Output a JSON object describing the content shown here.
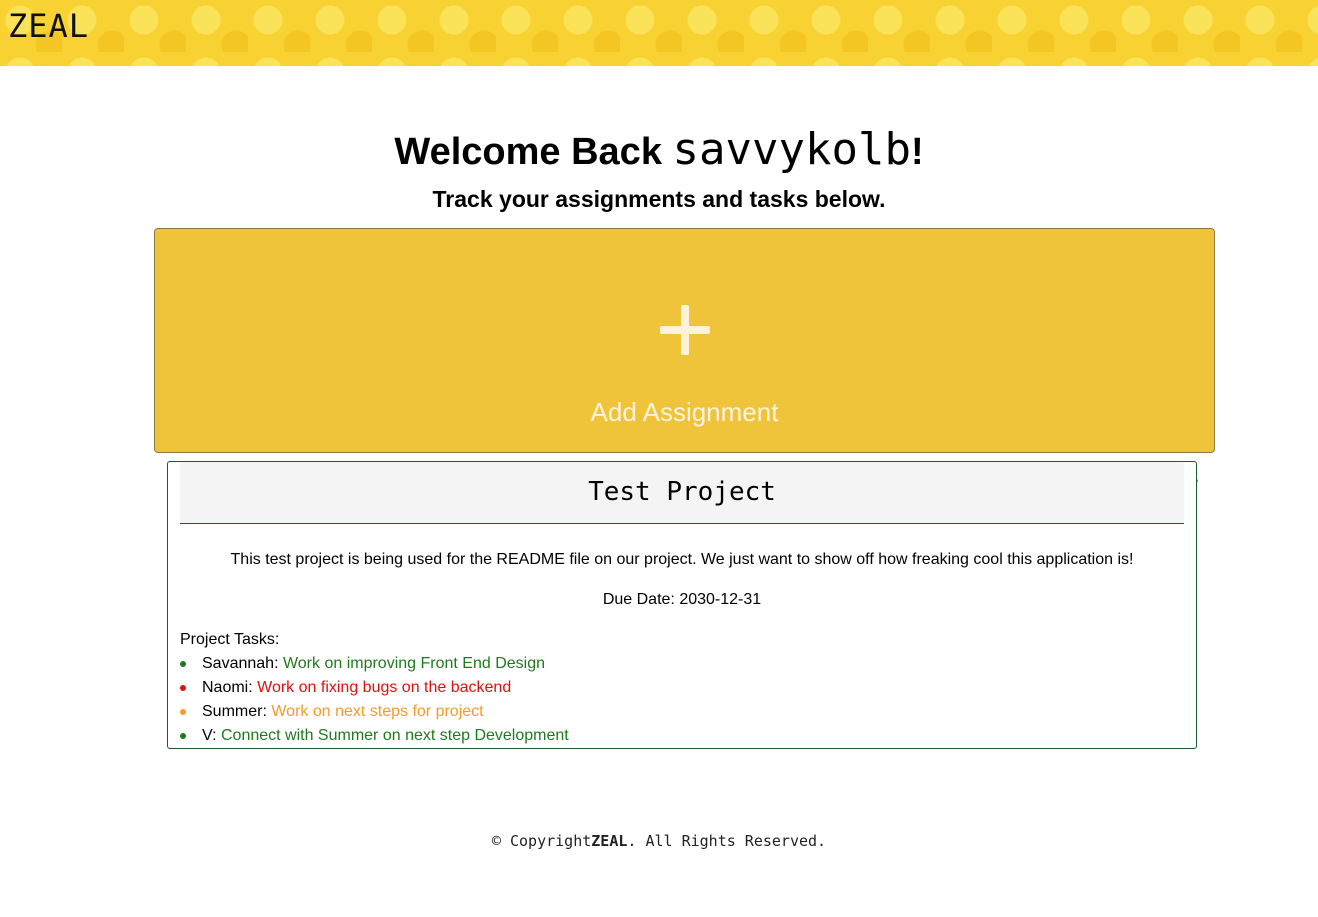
{
  "header": {
    "logo": "ZEAL",
    "background_color": "#f7d232"
  },
  "welcome": {
    "prefix": "Welcome Back ",
    "username": "savvykolb",
    "suffix": "!",
    "subtitle": "Track your assignments and tasks below."
  },
  "add_assignment": {
    "icon": "plus-icon",
    "label": "Add Assignment",
    "background_color": "#efc43a"
  },
  "project": {
    "title": "Test Project",
    "description": "This test project is being used for the README file on our project. We just want to show off how freaking cool this application is!",
    "due_date": "Due Date: 2030-12-31",
    "tasks_label": "Project Tasks:",
    "tasks": [
      {
        "name": "Savannah:",
        "task": "Work on improving Front End Design",
        "color": "#1f7a1f"
      },
      {
        "name": "Naomi:",
        "task": "Work on fixing bugs on the backend",
        "color": "#e01010"
      },
      {
        "name": "Summer:",
        "task": "Work on next steps for project",
        "color": "#f39c2a"
      },
      {
        "name": "V:",
        "task": "Connect with Summer on next step Development",
        "color": "#1f7a1f"
      }
    ]
  },
  "stray_mark": ",",
  "footer": {
    "prefix": "© Copyright",
    "brand": "ZEAL",
    "suffix": ". All Rights Reserved."
  }
}
